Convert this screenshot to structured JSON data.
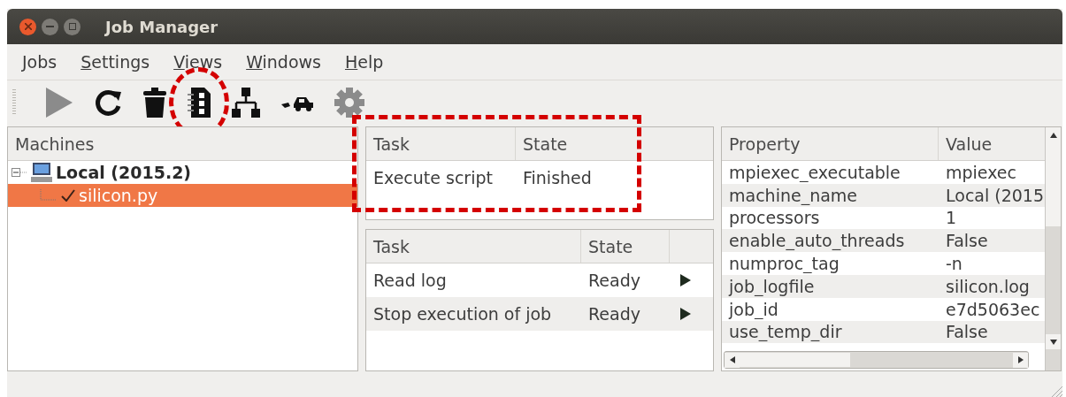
{
  "window": {
    "title": "Job Manager"
  },
  "menu": [
    {
      "label": "Jobs"
    },
    {
      "label": "Settings"
    },
    {
      "label": "Views"
    },
    {
      "label": "Windows"
    },
    {
      "label": "Help"
    }
  ],
  "toolbar": [
    {
      "kind": "run",
      "disabled": true,
      "highlighted": false
    },
    {
      "kind": "refresh",
      "disabled": false,
      "highlighted": false
    },
    {
      "kind": "delete",
      "disabled": false,
      "highlighted": false
    },
    {
      "kind": "log",
      "disabled": false,
      "highlighted": true
    },
    {
      "kind": "network",
      "disabled": false,
      "highlighted": false
    },
    {
      "kind": "transfer",
      "disabled": false,
      "highlighted": false
    },
    {
      "kind": "settings",
      "disabled": true,
      "highlighted": false
    }
  ],
  "machines": {
    "heading": "Machines",
    "items": [
      {
        "label": "Local (2015.2)",
        "expanded": true,
        "selected": false,
        "children": [
          {
            "label": "silicon.py",
            "selected": true,
            "finished": true
          }
        ]
      }
    ]
  },
  "running_tasks": {
    "highlighted": true,
    "columns": [
      "Task",
      "State"
    ],
    "rows": [
      {
        "task": "Execute script",
        "state": "Finished"
      }
    ]
  },
  "available_tasks": {
    "columns": [
      "Task",
      "State"
    ],
    "rows": [
      {
        "task": "Read log",
        "state": "Ready"
      },
      {
        "task": "Stop execution of job",
        "state": "Ready"
      }
    ]
  },
  "properties": {
    "columns": [
      "Property",
      "Value"
    ],
    "rows": [
      {
        "property": "mpiexec_executable",
        "value": "mpiexec"
      },
      {
        "property": "machine_name",
        "value": "Local (2015"
      },
      {
        "property": "processors",
        "value": "1"
      },
      {
        "property": "enable_auto_threads",
        "value": "False"
      },
      {
        "property": "numproc_tag",
        "value": "-n"
      },
      {
        "property": "job_logfile",
        "value": "silicon.log"
      },
      {
        "property": "job_id",
        "value": "e7d5063ec"
      },
      {
        "property": "use_temp_dir",
        "value": "False"
      }
    ]
  }
}
